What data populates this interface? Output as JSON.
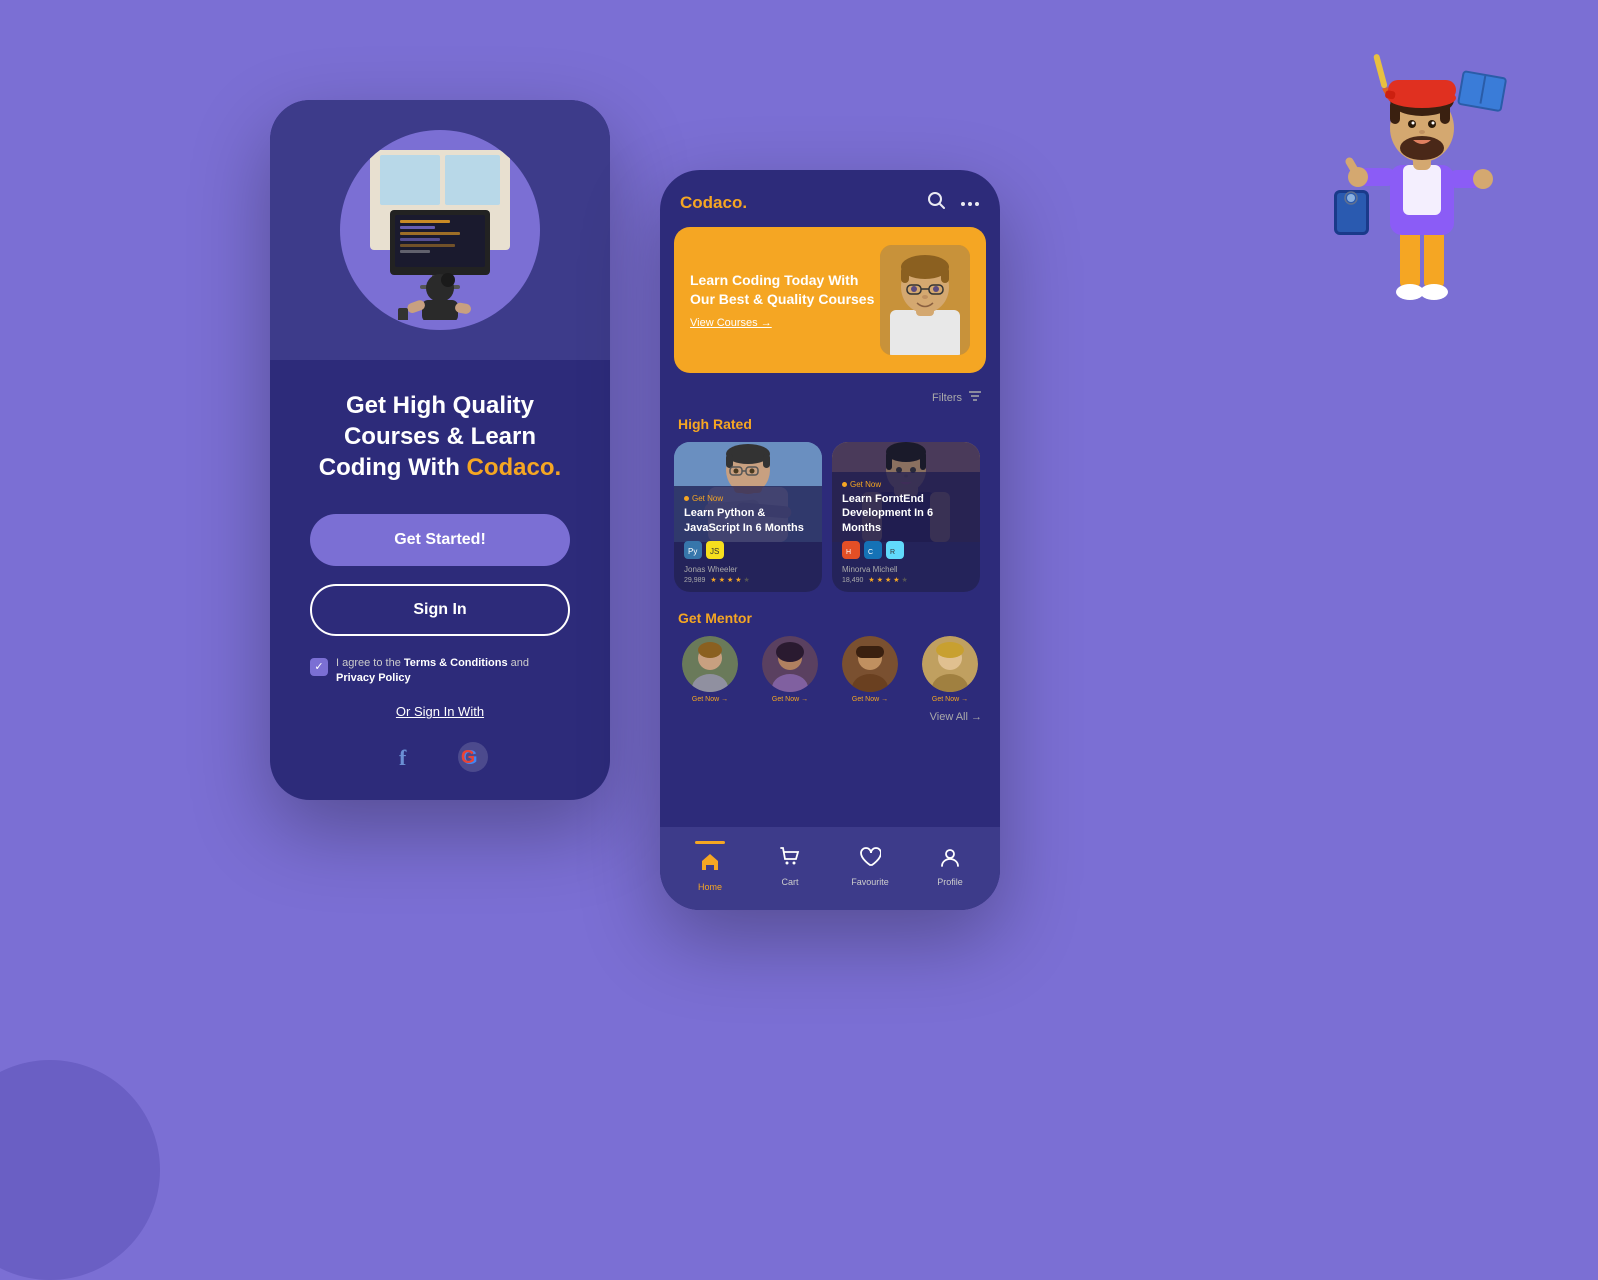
{
  "background": {
    "color": "#7B6FD4"
  },
  "phone_left": {
    "headline": "Get High Quality Courses & Learn Coding With ",
    "brand": "Codaco.",
    "btn_started": "Get Started!",
    "btn_signin": "Sign In",
    "terms_text": "I agree to the ",
    "terms_link1": "Terms & Conditions",
    "terms_and": " and ",
    "terms_link2": "Privacy Policy",
    "or_sign_in": "Or Sign In With"
  },
  "phone_right": {
    "logo": "Codaco.",
    "hero": {
      "title": "Learn Coding Today With Our Best & Quality Courses",
      "cta": "View Courses →"
    },
    "filters_label": "Filters",
    "section_high_rated": "High Rated",
    "courses": [
      {
        "get_now": "Get Now",
        "title": "Learn Python & JavaScript In 6 Months",
        "instructor": "Jonas Wheeler",
        "rating_count": "29,989",
        "stars": 4
      },
      {
        "get_now": "Get Now",
        "title": "Learn ForntEnd Development In 6 Months",
        "instructor": "Minorva Michell",
        "rating_count": "18,490",
        "stars": 4
      }
    ],
    "section_mentor": "Get Mentor",
    "mentors": [
      {
        "get_now": "Get Now →"
      },
      {
        "get_now": "Get Now →"
      },
      {
        "get_now": "Get Now →"
      },
      {
        "get_now": "Get Now →"
      }
    ],
    "view_all": "View All →",
    "nav": [
      {
        "label": "Home",
        "active": true
      },
      {
        "label": "Cart",
        "active": false
      },
      {
        "label": "Favourite",
        "active": false
      },
      {
        "label": "Profile",
        "active": false
      }
    ]
  }
}
